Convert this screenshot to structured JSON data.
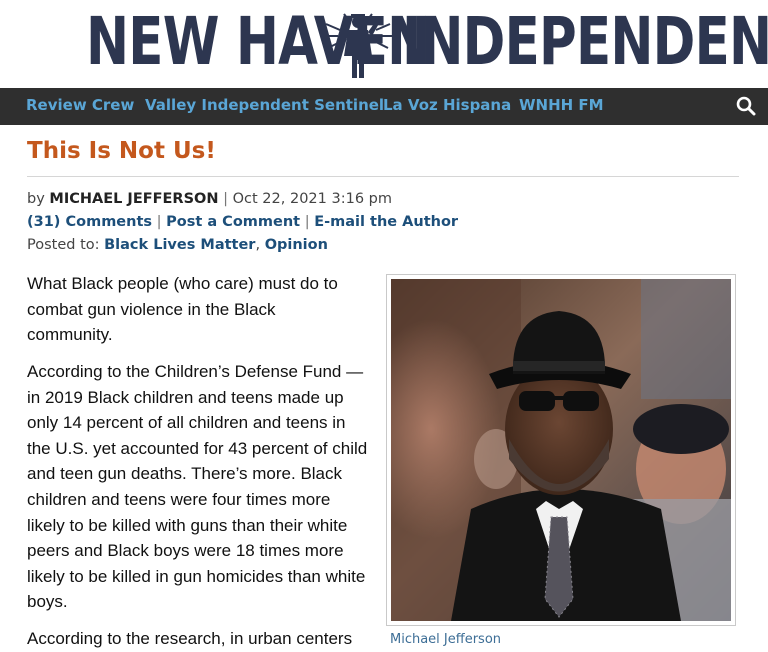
{
  "masthead": {
    "logo_left": "NEW HAVEN",
    "logo_right": "INDEPENDENT",
    "logo_color": "#2d3650"
  },
  "nav": {
    "items": [
      "Review Crew",
      "Valley Independent Sentinel",
      "La Voz Hispana",
      "WNHH FM"
    ],
    "search_icon": "search-icon",
    "link_color": "#5aa6d6",
    "bar_color": "#2f2f2f"
  },
  "article": {
    "title": "This Is Not Us!",
    "title_color": "#c4581d",
    "by_prefix": "by",
    "author": "MICHAEL JEFFERSON",
    "separator": "|",
    "date": "Oct 22, 2021 3:16 pm",
    "comments_link": "(31) Comments",
    "post_comment_link": "Post a Comment",
    "email_author_link": "E-mail the Author",
    "posted_to_label": "Posted to:",
    "categories": [
      "Black Lives Matter",
      "Opinion"
    ],
    "category_separator": ",",
    "paragraphs": [
      "What Black people (who care) must do to combat gun violence in the Black community.",
      "According to the Children’s Defense Fund — in 2019 Black children and teens made up only 14 percent of all children and teens in the U.S. yet accounted for 43 percent of child and teen gun deaths. There’s more. Black children and teens were four times more likely to be killed with guns than their white peers and Black boys were 18 times more likely to be killed in gun homicides than white boys.",
      "According to the research, in urban centers"
    ],
    "photo_caption": "Michael Jefferson"
  }
}
